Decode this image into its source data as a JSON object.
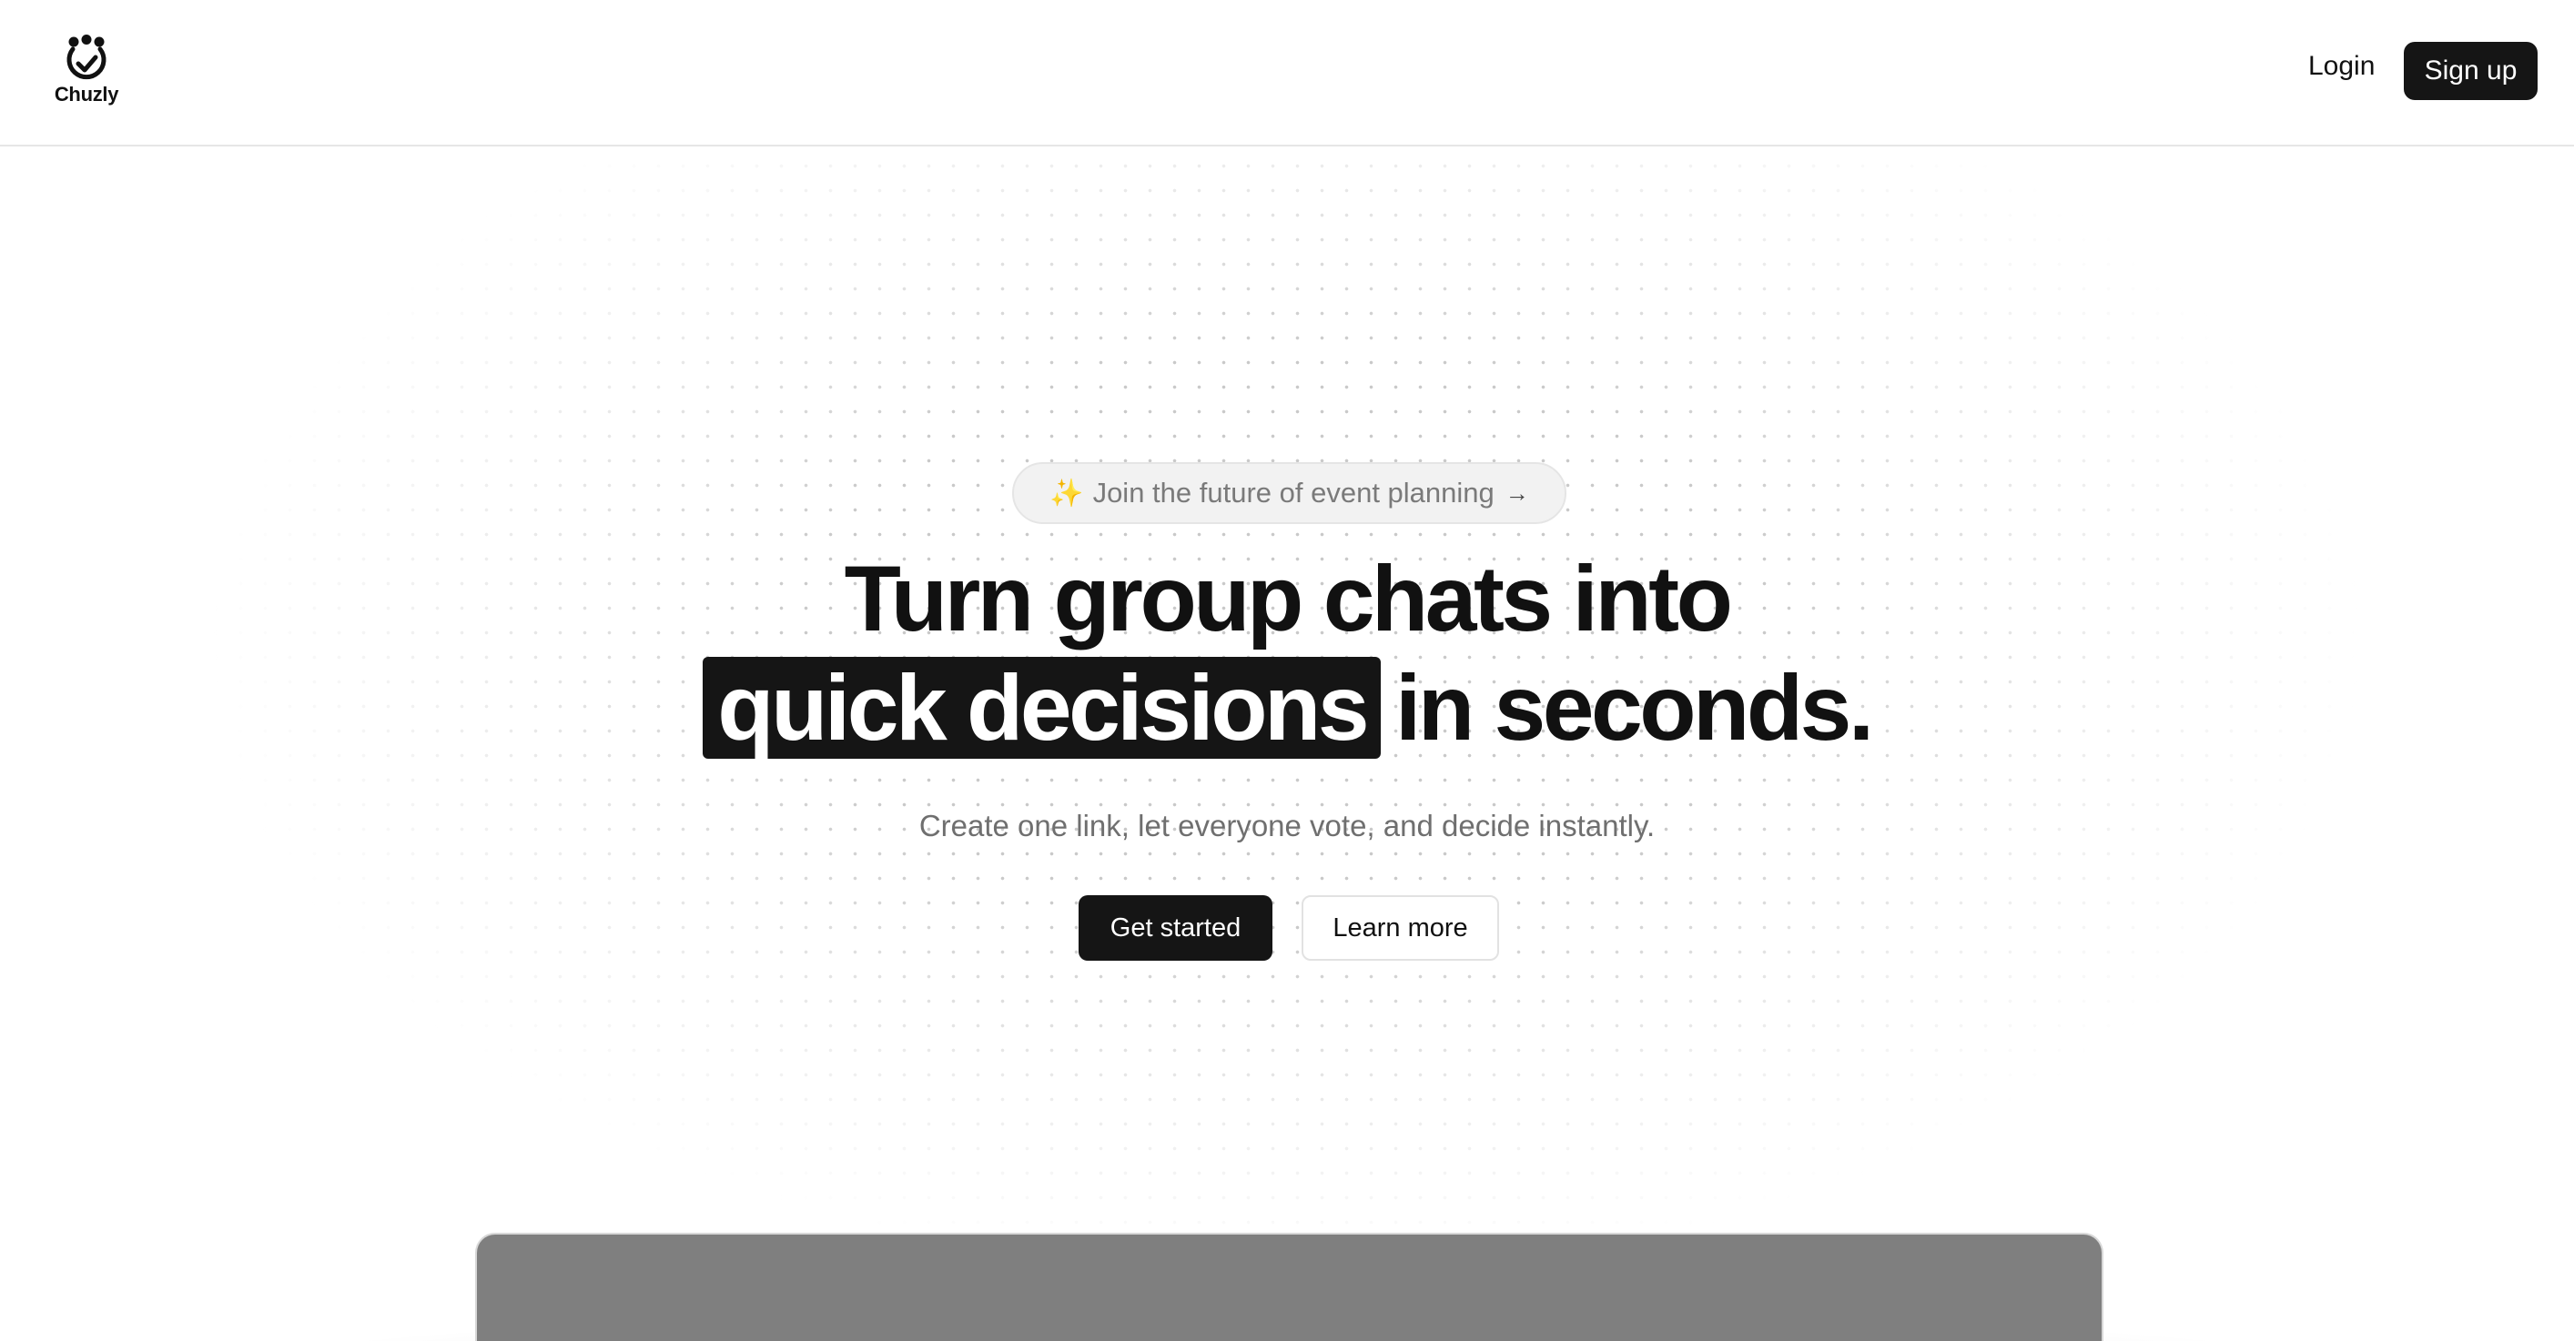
{
  "header": {
    "logo_text": "Chuzly",
    "login_label": "Login",
    "signup_label": "Sign up"
  },
  "hero": {
    "announcement": {
      "sparkle_icon": "sparkles-icon",
      "text": "Join the future of event planning",
      "arrow_icon": "arrow-right-icon"
    },
    "headline_line1": "Turn group chats into",
    "headline_highlight": "quick decisions",
    "headline_rest": "in seconds.",
    "subtext": "Create one link, let everyone vote, and decide instantly.",
    "primary_cta": "Get started",
    "secondary_cta": "Learn more"
  },
  "colors": {
    "primary": "#151515",
    "background": "#ffffff",
    "muted_text": "#6f6f6f",
    "sparkle": "#f1c85a",
    "preview": "#7f7f7f"
  }
}
